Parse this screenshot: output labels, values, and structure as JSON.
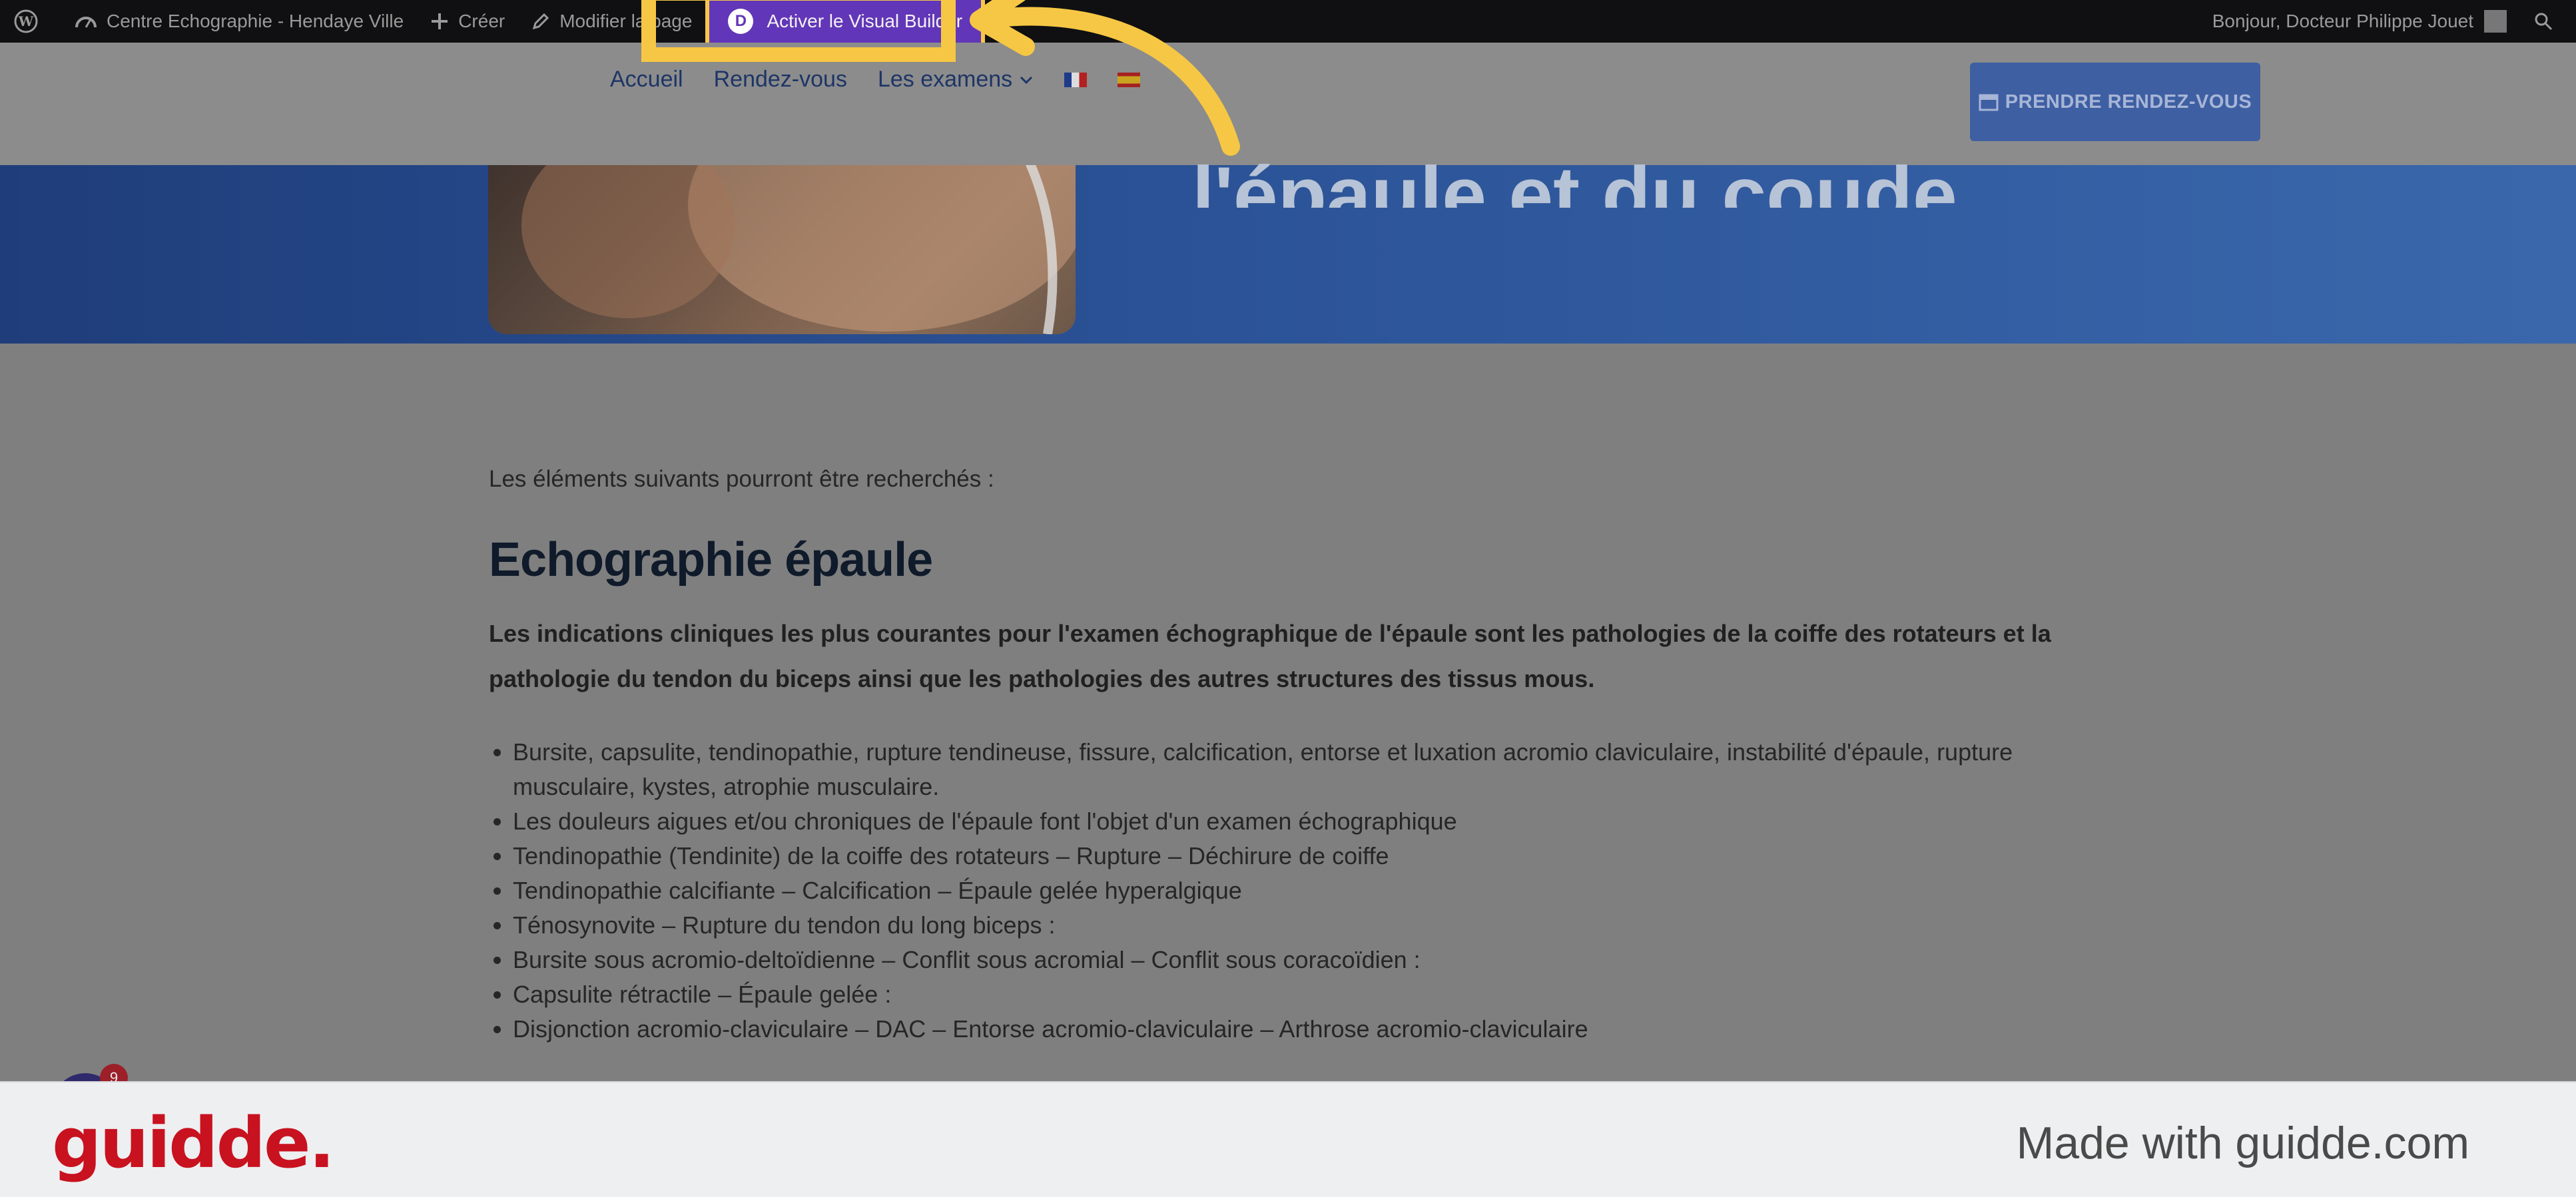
{
  "admin_bar": {
    "site_name": "Centre Echographie - Hendaye Ville",
    "create_label": "Créer",
    "edit_page_label": "Modifier la page",
    "visual_builder_label": "Activer le Visual Builder",
    "visual_builder_logo": "D",
    "greeting": "Bonjour, Docteur Philippe Jouet"
  },
  "nav": {
    "items": [
      "Accueil",
      "Rendez-vous",
      "Les examens"
    ],
    "cta_label": "PRENDRE RENDEZ-VOUS"
  },
  "hero": {
    "title": "l'épaule et du coude"
  },
  "content": {
    "intro": "Les éléments suivants pourront être recherchés :",
    "section_title": "Echographie épaule",
    "section_lead": "Les indications cliniques les plus courantes pour l'examen échographique de l'épaule sont les pathologies de la coiffe des rotateurs et la pathologie du tendon du biceps ainsi que les pathologies des autres structures des tissus mous.",
    "bullets": [
      "Bursite, capsulite, tendinopathie, rupture tendineuse, fissure, calcification, entorse et luxation acromio claviculaire, instabilité d'épaule, rupture musculaire, kystes, atrophie musculaire.",
      "Les douleurs aigues et/ou chroniques de l'épaule font l'objet d'un examen échographique",
      "Tendinopathie (Tendinite) de la coiffe des rotateurs – Rupture – Déchirure de coiffe",
      "Tendinopathie calcifiante – Calcification – Épaule gelée hyperalgique",
      "Ténosynovite – Rupture du tendon du long biceps :",
      "Bursite sous acromio-deltoïdienne – Conflit sous acromial – Conflit sous coracoïdien :",
      "Capsulite rétractile – Épaule gelée :",
      "Disjonction acromio-claviculaire – DAC – Entorse acromio-claviculaire – Arthrose acromio-claviculaire"
    ]
  },
  "chat": {
    "badge_count": "9"
  },
  "footer": {
    "logo": "guidde.",
    "made_with": "Made with guidde.com"
  },
  "colors": {
    "accent_purple": "#6236b8",
    "highlight_yellow": "#f6c744",
    "brand_red": "#c8121f"
  }
}
